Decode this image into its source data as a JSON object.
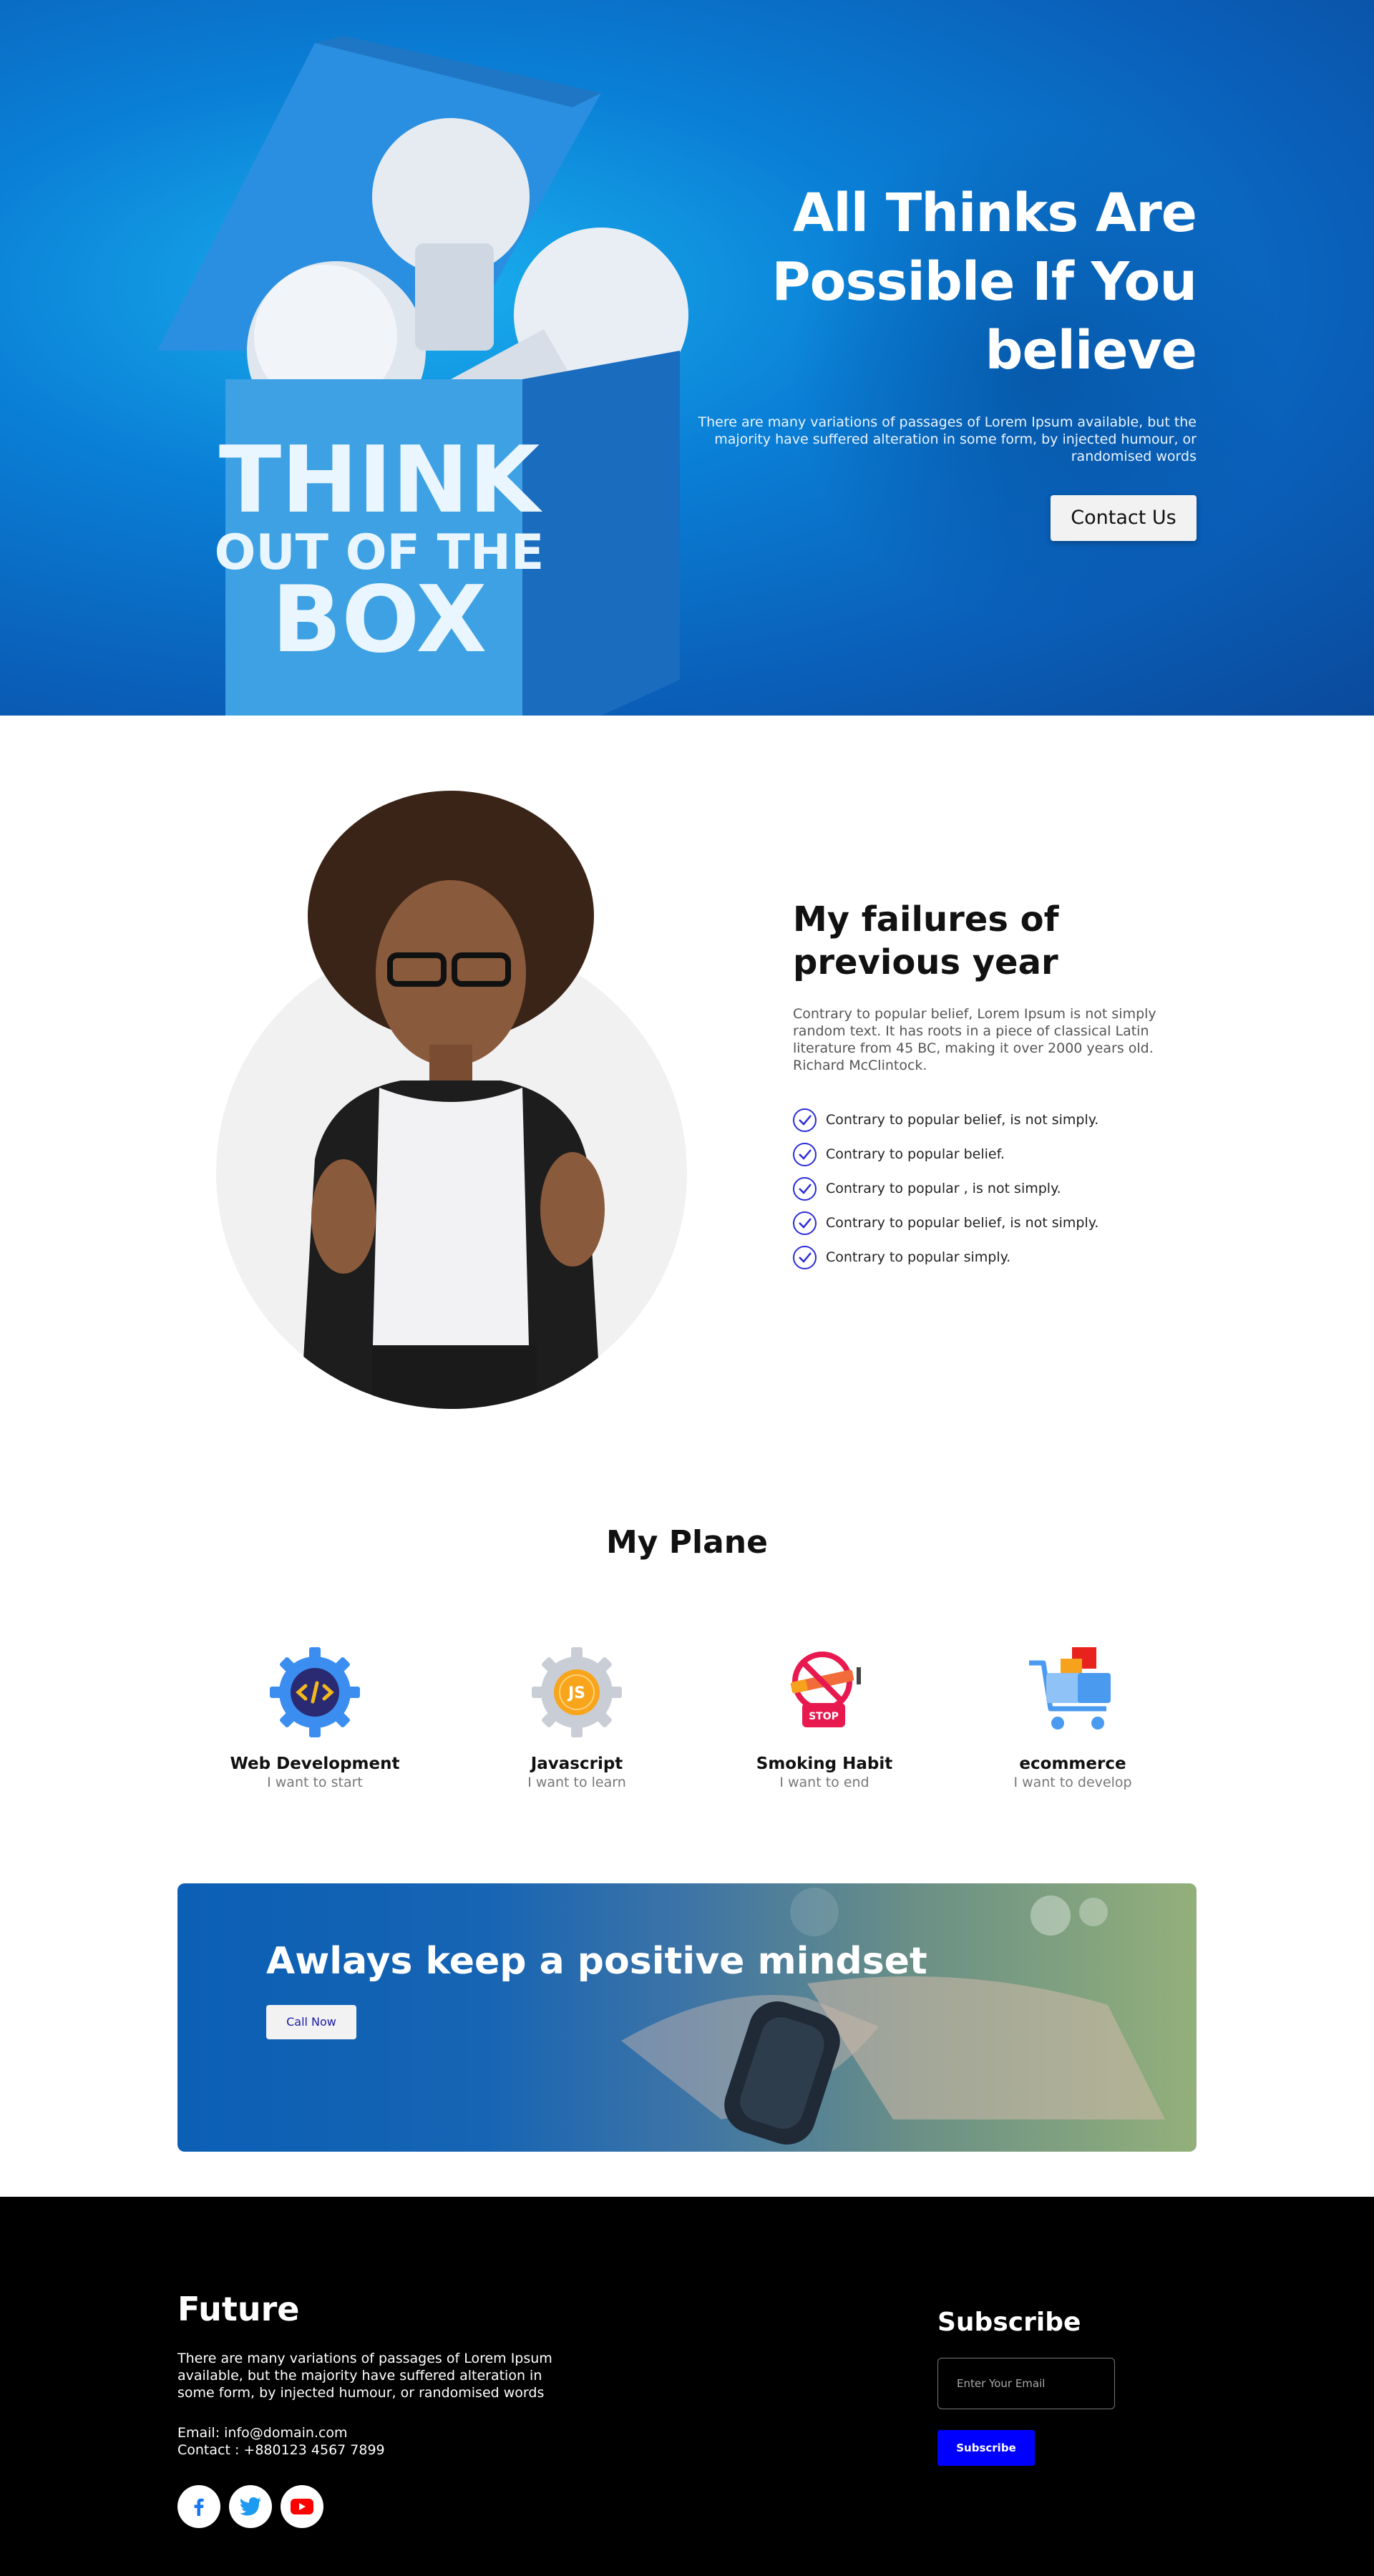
{
  "hero": {
    "title": "All Thinks Are Possible If You believe",
    "subtitle": "There are many variations of passages of Lorem Ipsum available, but the majority have suffered alteration in some form, by injected humour, or randomised words",
    "button": "Contact Us",
    "box_text": [
      "THINK",
      "OUT OF THE",
      "BOX"
    ]
  },
  "failures": {
    "title": "My failures of previous year",
    "description": "Contrary to popular belief, Lorem Ipsum is not simply random text. It has roots in a piece of classical Latin literature from 45 BC, making it over 2000 years old. Richard McClintock.",
    "items": [
      "Contrary to popular belief, is not simply.",
      "Contrary to popular belief.",
      "Contrary to popular , is not simply.",
      "Contrary to popular belief, is not simply.",
      "Contrary to popular simply."
    ]
  },
  "plane": {
    "title": "My Plane",
    "items": [
      {
        "name": "Web Development",
        "sub": "I want to start",
        "icon": "code-gear-icon"
      },
      {
        "name": "Javascript",
        "sub": "I want to learn",
        "icon": "js-gear-icon"
      },
      {
        "name": "Smoking Habit",
        "sub": "I want to end",
        "icon": "no-smoking-icon"
      },
      {
        "name": "ecommerce",
        "sub": "I want to develop",
        "icon": "shopping-cart-icon"
      }
    ],
    "js_label": "JS",
    "stop_label": "STOP"
  },
  "banner": {
    "title": "Awlays keep a positive mindset",
    "button": "Call Now"
  },
  "footer": {
    "brand": "Future",
    "description": "There are many variations of passages of Lorem Ipsum available, but the majority have suffered alteration in some form, by injected humour, or randomised words",
    "email": "Email: info@domain.com",
    "contact": "Contact : +880123 4567 7899",
    "subscribe_title": "Subscribe",
    "email_placeholder": "Enter Your Email",
    "subscribe_button": "Subscribe"
  },
  "colors": {
    "accent": "#0000ff",
    "check": "#2b2bd9",
    "hero_blue": "#0a7fd6"
  }
}
